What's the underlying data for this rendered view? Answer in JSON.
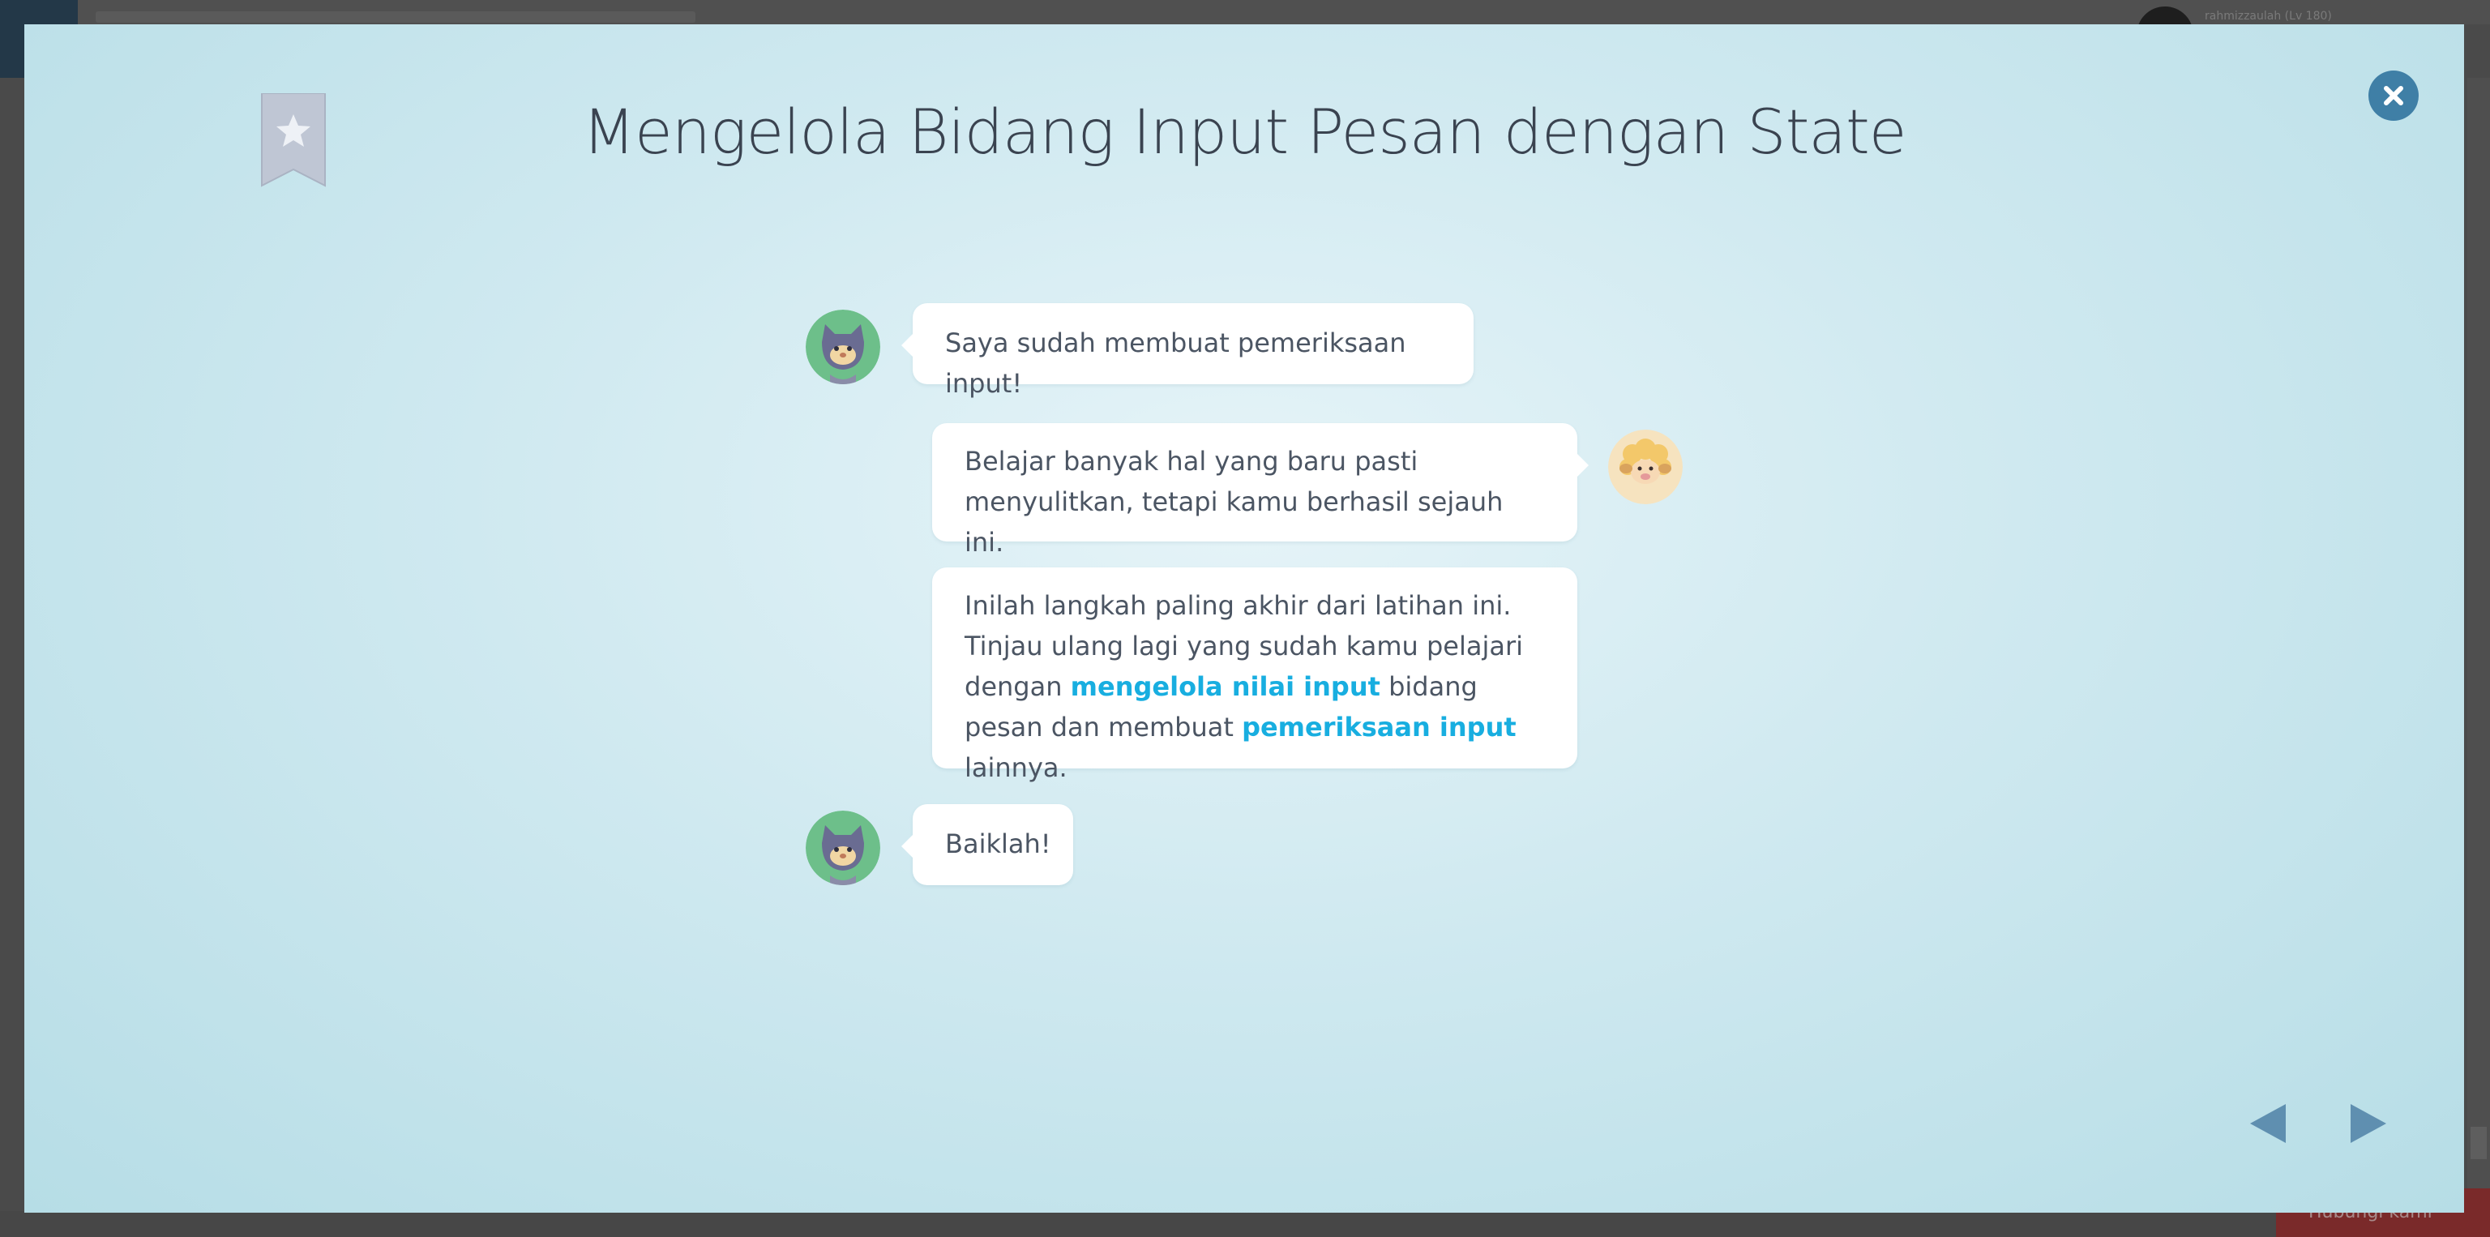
{
  "background": {
    "username": "rahmizzaulah (Lv 180)",
    "help_label": "Hubungi kami"
  },
  "modal": {
    "title": "Mengelola Bidang Input Pesan dengan State",
    "accent_color": "#18aee0",
    "close_color": "#3f7fa6"
  },
  "messages": [
    {
      "speaker": "cat-character",
      "side": "left",
      "text": "Saya sudah membuat pemeriksaan input!"
    },
    {
      "speaker": "sheep-character",
      "side": "right",
      "text": "Belajar banyak hal yang baru pasti menyulitkan, tetapi kamu berhasil sejauh ini."
    },
    {
      "speaker": "sheep-character",
      "side": "right",
      "parts": {
        "t1": "Inilah langkah paling akhir dari latihan ini. Tinjau ulang lagi yang sudah kamu pelajari dengan ",
        "h1": "mengelola nilai input",
        "t2": " bidang pesan dan membuat ",
        "h2": "pemeriksaan input",
        "t3": " lainnya."
      }
    },
    {
      "speaker": "cat-character",
      "side": "left",
      "text": "Baiklah!"
    }
  ],
  "navigation": {
    "prev_icon": "triangle-left-icon",
    "next_icon": "triangle-right-icon",
    "arrow_color": "#5f8fb0"
  }
}
